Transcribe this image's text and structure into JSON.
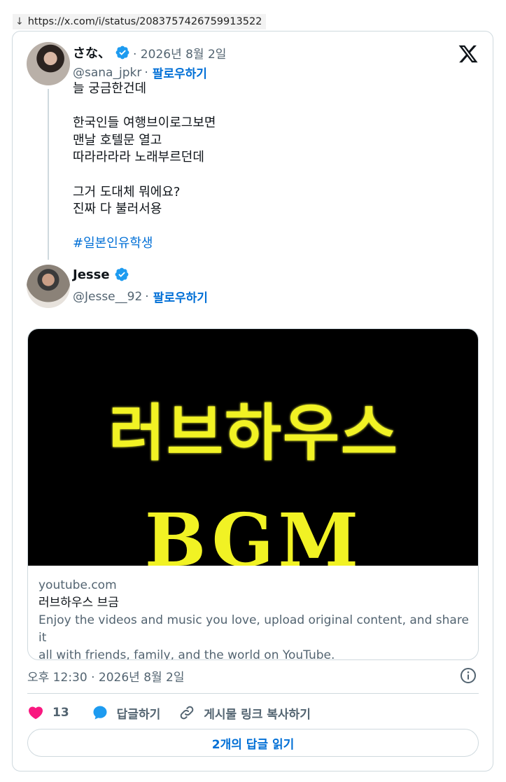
{
  "browser": {
    "url": "https://x.com/i/status/2083757426759913522"
  },
  "tweet": {
    "author": {
      "name": "さな、",
      "handle": "@sana_jpkr",
      "follow_label": "팔로우하기",
      "date": "· 2026년 8월 2일"
    },
    "text_lines": [
      "늘 궁금한건데",
      "",
      "한국인들 여행브이로그보면",
      "맨날 호텔문 열고",
      "따라라라라 노래부르던데",
      "",
      "그거 도대체 뭐에요?",
      "진짜 다 불러서용",
      ""
    ],
    "hashtag": "#일본인유학생"
  },
  "reply": {
    "author": {
      "name": "Jesse",
      "handle": "@Jesse__92",
      "follow_label": "팔로우하기"
    },
    "link_card": {
      "thumbnail_line1": "러브하우스",
      "thumbnail_line2": "BGM",
      "domain": "youtube.com",
      "title": "러브하우스 브금",
      "description_line1": "Enjoy the videos and music you love, upload original content, and share it",
      "description_line2": "all with friends, family, and the world on YouTube."
    },
    "timestamp": "오후 12:30 · 2026년 8월 2일",
    "actions": {
      "like_count": "13",
      "reply_label": "답글하기",
      "copy_label": "게시물 링크 복사하기"
    },
    "read_replies_label": "2개의 답글 읽기"
  },
  "colors": {
    "accent": "#006fd6",
    "verified": "#1d9bf0",
    "like": "#f91880",
    "thumbnail_text": "#f1f224"
  }
}
